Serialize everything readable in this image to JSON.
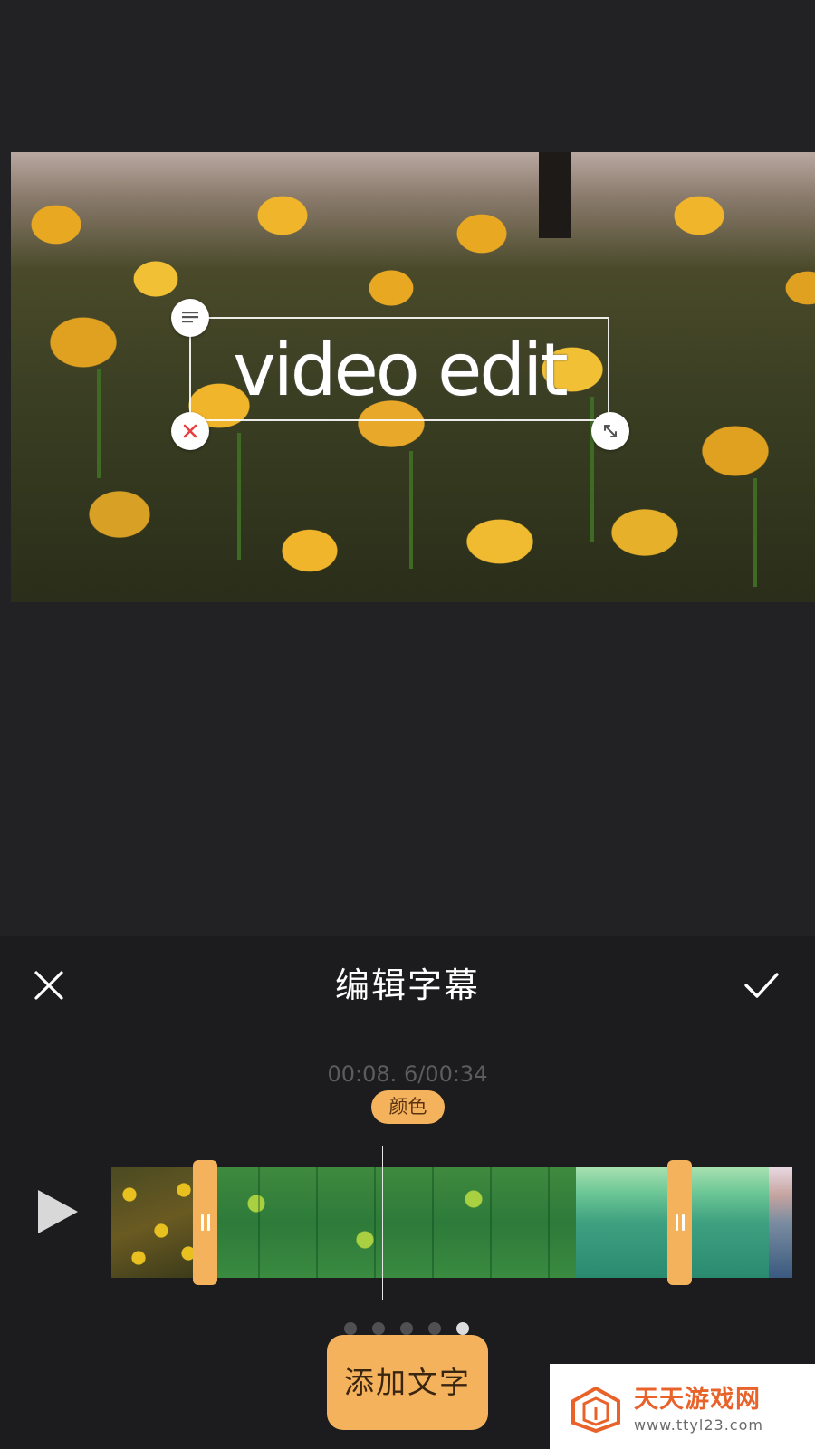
{
  "preview": {
    "caption_text": "video edit"
  },
  "editor": {
    "title": "编辑字幕",
    "timecode": "00:08. 6/00:34",
    "color_chip_label": "颜色",
    "add_text_label": "添加文字",
    "page_dots_count": 5,
    "active_dot_index": 4
  },
  "watermark": {
    "title": "天天游戏网",
    "url": "www.ttyl23.com"
  },
  "colors": {
    "accent": "#f4b25c",
    "background": "#222224",
    "panel": "#1c1c1e",
    "delete_red": "#e84040",
    "watermark_orange": "#e8622a"
  },
  "icons": [
    "text-style-icon",
    "delete-icon",
    "resize-icon",
    "close-icon",
    "check-icon",
    "play-icon",
    "trim-handle-icon",
    "watermark-logo-icon"
  ]
}
